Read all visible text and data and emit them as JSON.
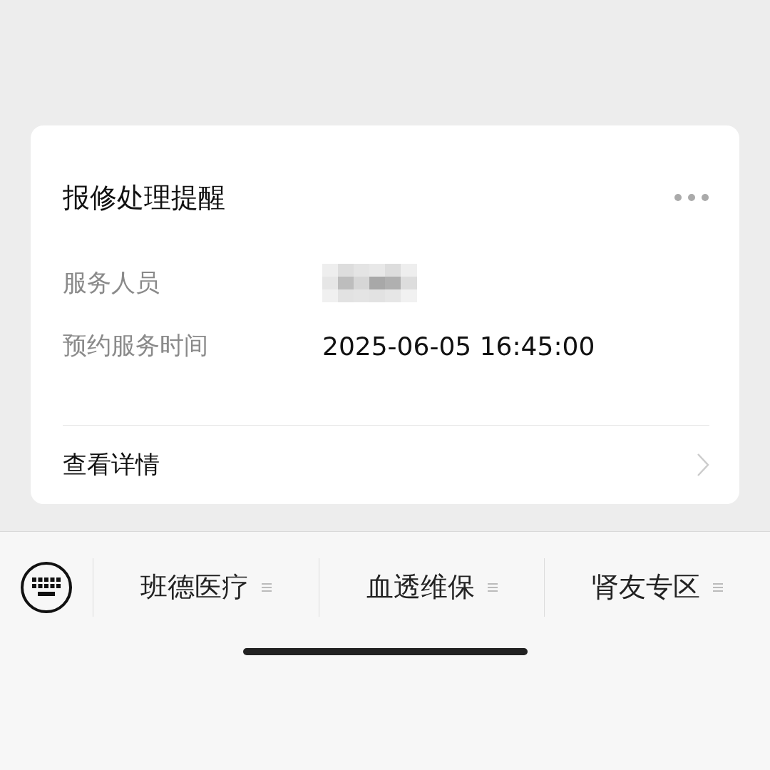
{
  "card": {
    "title": "报修处理提醒",
    "fields": [
      {
        "label": "服务人员",
        "redacted": true
      },
      {
        "label": "预约服务时间",
        "value": "2025-06-05 16:45:00",
        "redacted": false
      }
    ],
    "link": "查看详情"
  },
  "menu": {
    "items": [
      {
        "label": "班德医疗"
      },
      {
        "label": "血透维保"
      },
      {
        "label": "肾友专区"
      }
    ]
  }
}
